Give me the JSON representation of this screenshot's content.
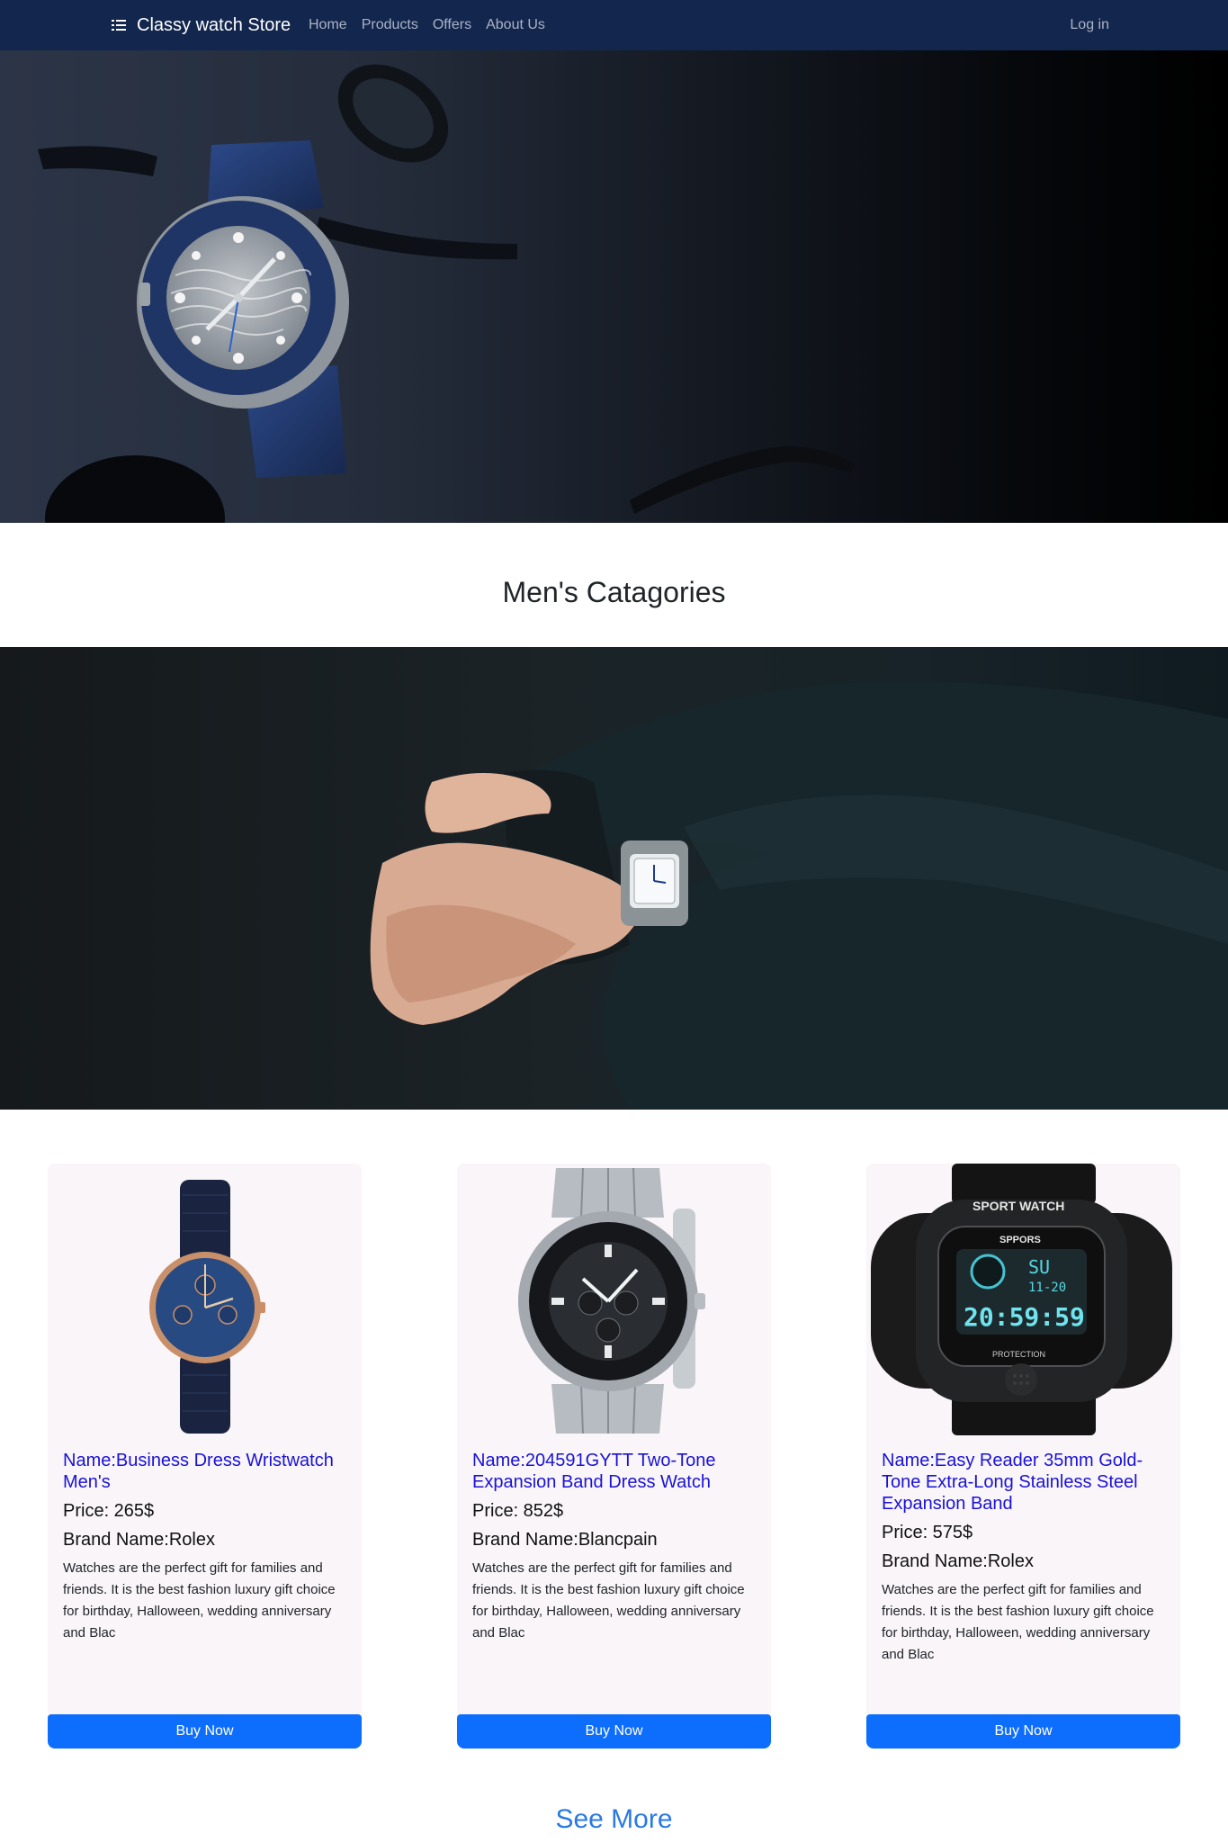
{
  "navbar": {
    "brand_icon": "list-icon",
    "brand": "Classy watch Store",
    "links": [
      "Home",
      "Products",
      "Offers",
      "About Us"
    ],
    "login": "Log in",
    "bg_color": "#13264d"
  },
  "hero": {
    "image": "luxury-dive-watch-photo"
  },
  "section": {
    "title": "Men's Catagories"
  },
  "banner": {
    "image": "man-wearing-wristwatch-photo"
  },
  "products": [
    {
      "image": "leather-strap-dress-watch",
      "name": "Name:Business Dress Wristwatch Men's",
      "price": "Price: 265$",
      "brand": "Brand Name:Rolex",
      "description": "Watches are the perfect gift for families and friends. It is the best fashion luxury gift choice for birthday, Halloween, wedding anniversary and Blac",
      "button": "Buy Now"
    },
    {
      "image": "steel-chronograph-watch",
      "name": "Name:204591GYTT Two-Tone Expansion Band Dress Watch",
      "price": "Price: 852$",
      "brand": "Brand Name:Blancpain",
      "description": "Watches are the perfect gift for families and friends. It is the best fashion luxury gift choice for birthday, Halloween, wedding anniversary and Blac",
      "button": "Buy Now"
    },
    {
      "image": "digital-sport-watch",
      "name": "Name:Easy Reader 35mm Gold-Tone Extra-Long Stainless Steel Expansion Band",
      "price": "Price: 575$",
      "brand": "Brand Name:Rolex",
      "description": "Watches are the perfect gift for families and friends. It is the best fashion luxury gift choice for birthday, Halloween, wedding anniversary and Blac",
      "button": "Buy Now"
    }
  ],
  "digital_watch_text": {
    "top": "SPORT WATCH",
    "sub": "SPPORS",
    "time": "20:59:59",
    "small": "11-20",
    "day": "SU",
    "bottom": "PROTECTION"
  },
  "see_more": "See More",
  "colors": {
    "accent": "#0d6efd",
    "product_name": "#1a12d6",
    "see_more": "#2a7ae4",
    "card_bg": "#f9f5f9"
  }
}
